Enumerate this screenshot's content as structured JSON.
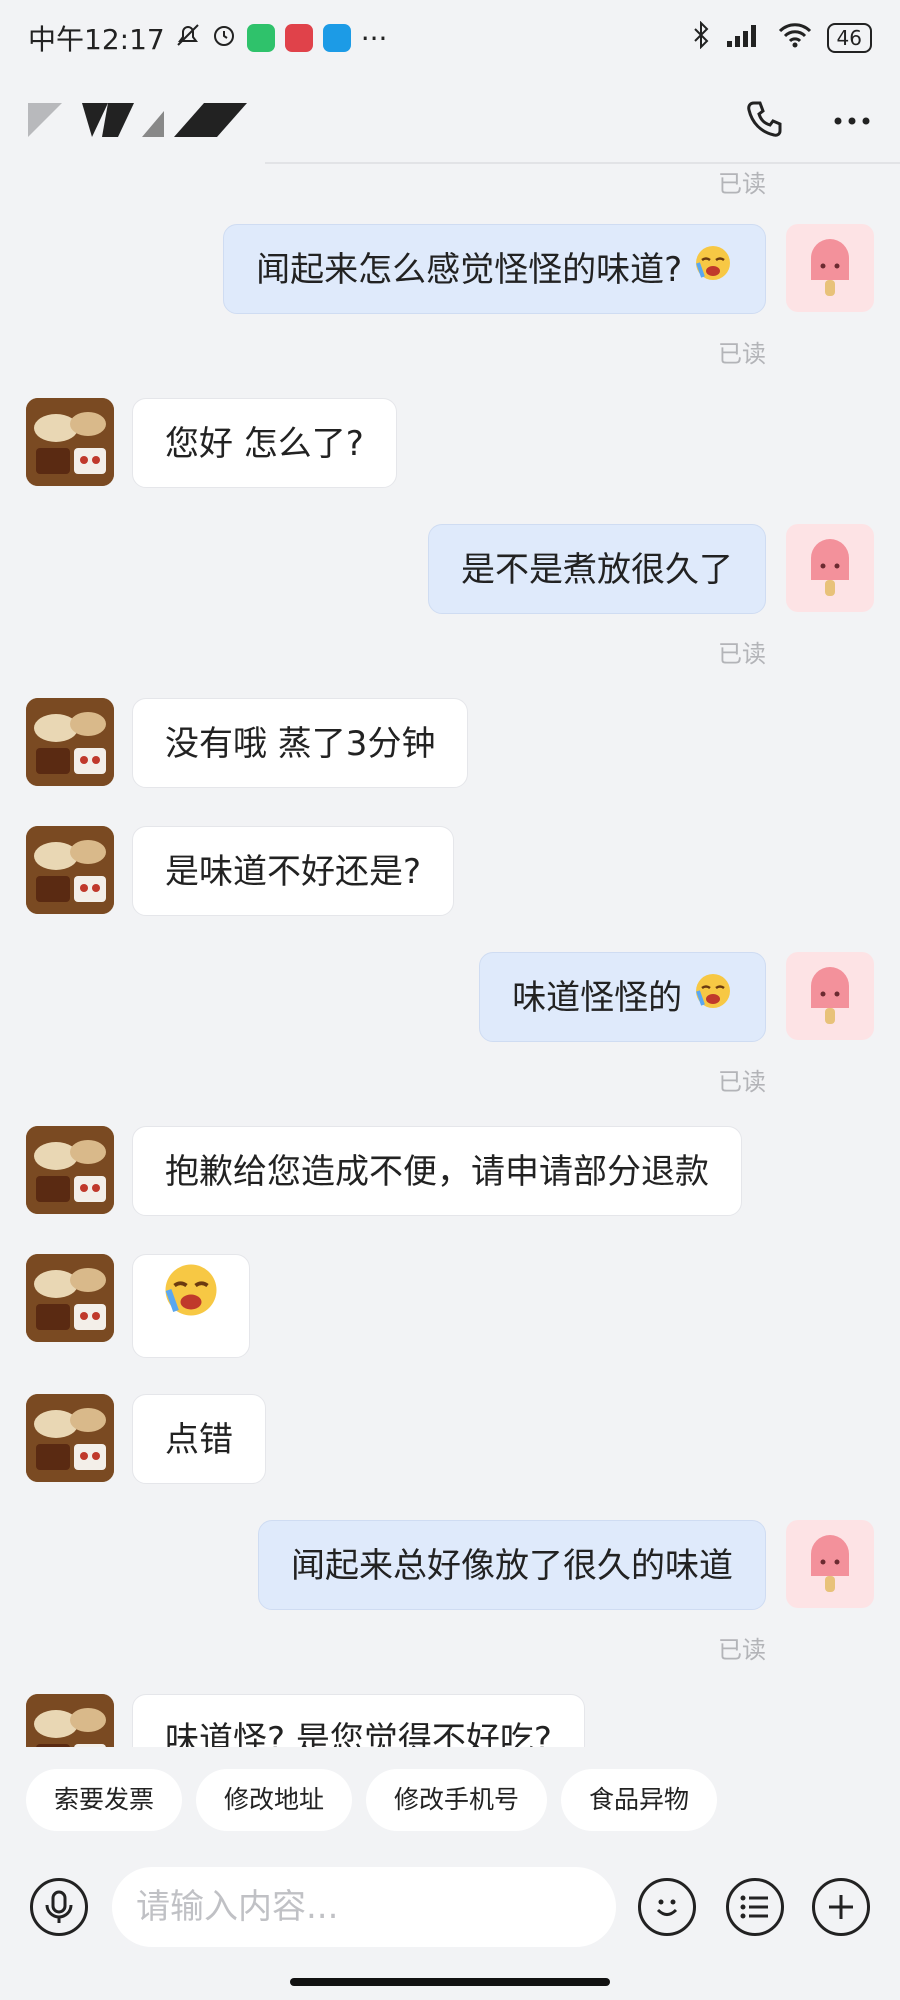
{
  "status_bar": {
    "time": "中午12:17",
    "more": "···",
    "battery": "46"
  },
  "header": {
    "phone_icon": "phone-icon",
    "more_icon": "more-icon"
  },
  "read_label": "已读",
  "messages": [
    {
      "side": "out",
      "text": "闻起来怎么感觉怪怪的味道?",
      "emoji": "crying-emoji",
      "read": "已读"
    },
    {
      "side": "in",
      "text": "您好  怎么了?"
    },
    {
      "side": "out",
      "text": "是不是煮放很久了",
      "read": "已读"
    },
    {
      "side": "in",
      "text": "没有哦  蒸了3分钟"
    },
    {
      "side": "in",
      "text": "是味道不好还是?"
    },
    {
      "side": "out",
      "text": "味道怪怪的",
      "emoji": "crying-emoji",
      "read": "已读"
    },
    {
      "side": "in",
      "text": "抱歉给您造成不便，请申请部分退款"
    },
    {
      "side": "in",
      "text": "",
      "emoji": "crying-emoji"
    },
    {
      "side": "in",
      "text": "点错"
    },
    {
      "side": "out",
      "text": "闻起来总好像放了很久的味道",
      "read": "已读"
    },
    {
      "side": "in",
      "text": "味道怪?  是您觉得不好吃?"
    }
  ],
  "quick_replies": [
    "索要发票",
    "修改地址",
    "修改手机号",
    "食品异物"
  ],
  "input": {
    "placeholder": "请输入内容..."
  },
  "colors": {
    "background": "#f2f3f5",
    "outgoing_bubble": "#dfeafb",
    "incoming_bubble": "#ffffff",
    "read_text": "#b3b4b8"
  }
}
